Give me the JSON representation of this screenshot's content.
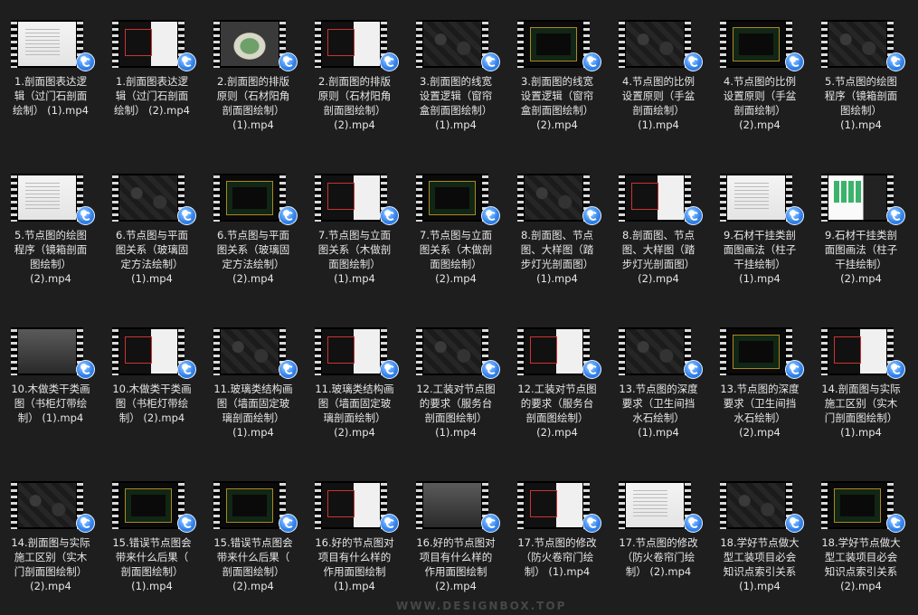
{
  "files": [
    {
      "name": "1.剖面图表达逻\n辑（过门石剖面\n绘制） (1).mp4",
      "style": "light"
    },
    {
      "name": "1.剖面图表达逻\n辑（过门石剖面\n绘制） (2).mp4",
      "style": "mix"
    },
    {
      "name": "2.剖面图的排版\n原则（石材阳角\n剖面图绘制）\n(1).mp4",
      "style": "stadium"
    },
    {
      "name": "2.剖面图的排版\n原则（石材阳角\n剖面图绘制）\n(2).mp4",
      "style": "mix"
    },
    {
      "name": "3.剖面图的线宽\n设置逻辑（窗帘\n盒剖面图绘制）\n(1).mp4",
      "style": "dark"
    },
    {
      "name": "3.剖面图的线宽\n设置逻辑（窗帘\n盒剖面图绘制）\n(2).mp4",
      "style": "cad"
    },
    {
      "name": "4.节点图的比例\n设置原则（手盆\n剖面绘制）\n(1).mp4",
      "style": "dark"
    },
    {
      "name": "4.节点图的比例\n设置原则（手盆\n剖面绘制）\n(2).mp4",
      "style": "cad"
    },
    {
      "name": "5.节点图的绘图\n程序（镜箱剖面\n图绘制）\n(1).mp4",
      "style": "dark"
    },
    {
      "name": "5.节点图的绘图\n程序（镜箱剖面\n图绘制）\n(2).mp4",
      "style": "light"
    },
    {
      "name": "6.节点图与平面\n图关系（玻璃固\n定方法绘制）\n(1).mp4",
      "style": "dark"
    },
    {
      "name": "6.节点图与平面\n图关系（玻璃固\n定方法绘制）\n(2).mp4",
      "style": "cad"
    },
    {
      "name": "7.节点图与立面\n图关系（木做剖\n面图绘制）\n(1).mp4",
      "style": "mix"
    },
    {
      "name": "7.节点图与立面\n图关系（木做剖\n面图绘制）\n(2).mp4",
      "style": "cad"
    },
    {
      "name": "8.剖面图、节点\n图、大样图（踏\n步灯光剖面图）\n(1).mp4",
      "style": "dark"
    },
    {
      "name": "8.剖面图、节点\n图、大样图（踏\n步灯光剖面图）\n(2).mp4",
      "style": "mix"
    },
    {
      "name": "9.石材干挂类剖\n面图画法（柱子\n干挂绘制）\n(1).mp4",
      "style": "light"
    },
    {
      "name": "9.石材干挂类剖\n面图画法（柱子\n干挂绘制）\n(2).mp4",
      "style": "green"
    },
    {
      "name": "10.木做类干类画\n图（书柜灯带绘\n制） (1).mp4",
      "style": "gray"
    },
    {
      "name": "10.木做类干类画\n图（书柜灯带绘\n制） (2).mp4",
      "style": "mix"
    },
    {
      "name": "11.玻璃类结构画\n图（墙面固定玻\n璃剖面绘制）\n(1).mp4",
      "style": "dark"
    },
    {
      "name": "11.玻璃类结构画\n图（墙面固定玻\n璃剖面绘制）\n(2).mp4",
      "style": "mix"
    },
    {
      "name": "12.工装对节点图\n的要求（服务台\n剖面图绘制）\n(1).mp4",
      "style": "dark"
    },
    {
      "name": "12.工装对节点图\n的要求（服务台\n剖面图绘制）\n(2).mp4",
      "style": "mix"
    },
    {
      "name": "13.节点图的深度\n要求（卫生间挡\n水石绘制）\n(1).mp4",
      "style": "dark"
    },
    {
      "name": "13.节点图的深度\n要求（卫生间挡\n水石绘制）\n(2).mp4",
      "style": "cad"
    },
    {
      "name": "14.剖面图与实际\n施工区别（实木\n门剖面图绘制）\n(1).mp4",
      "style": "mix"
    },
    {
      "name": "14.剖面图与实际\n施工区别（实木\n门剖面图绘制）\n(2).mp4",
      "style": "dark"
    },
    {
      "name": "15.错误节点图会\n带来什么后果（\n剖面图绘制）\n(1).mp4",
      "style": "cad"
    },
    {
      "name": "15.错误节点图会\n带来什么后果（\n剖面图绘制）\n(2).mp4",
      "style": "cad"
    },
    {
      "name": "16.好的节点图对\n项目有什么样的\n作用面图绘制\n(1).mp4",
      "style": "mix"
    },
    {
      "name": "16.好的节点图对\n项目有什么样的\n作用面图绘制\n(2).mp4",
      "style": "gray"
    },
    {
      "name": "17.节点图的修改\n（防火卷帘门绘\n制） (1).mp4",
      "style": "mix"
    },
    {
      "name": "17.节点图的修改\n（防火卷帘门绘\n制） (2).mp4",
      "style": "light"
    },
    {
      "name": "18.学好节点做大\n型工装项目必会\n知识点索引关系\n(1).mp4",
      "style": "dark"
    },
    {
      "name": "18.学好节点做大\n型工装项目必会\n知识点索引关系\n(2).mp4",
      "style": "cad"
    }
  ],
  "watermark": "WWW.DESIGNBOX.TOP",
  "colors": {
    "background": "#1e1e1e",
    "text": "#e6e6e6",
    "badge": "#2f7ee6"
  }
}
